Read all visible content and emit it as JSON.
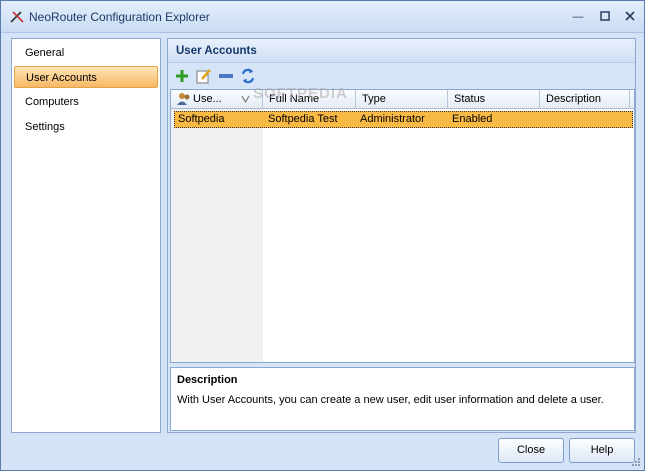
{
  "window": {
    "title": "NeoRouter Configuration Explorer"
  },
  "nav": {
    "items": [
      {
        "label": "General"
      },
      {
        "label": "User Accounts"
      },
      {
        "label": "Computers"
      },
      {
        "label": "Settings"
      }
    ],
    "selected": "User Accounts"
  },
  "content": {
    "title": "User Accounts",
    "toolbar": {
      "icons": [
        "add-icon",
        "edit-icon",
        "remove-icon",
        "refresh-icon"
      ]
    },
    "table": {
      "columns": [
        "Use...",
        "Full Name",
        "Type",
        "Status",
        "Description"
      ],
      "rows": [
        {
          "user": "Softpedia",
          "full_name": "Softpedia Test",
          "type": "Administrator",
          "status": "Enabled",
          "description": ""
        }
      ]
    },
    "description": {
      "title": "Description",
      "text": "With User Accounts, you can create a new user, edit user information and delete a user."
    }
  },
  "buttons": {
    "close": "Close",
    "help": "Help"
  },
  "watermark": "SOFTPEDIA",
  "colors": {
    "selection": "#f9ba45",
    "accent": "#15396b",
    "frame": "#d5e4f7"
  }
}
